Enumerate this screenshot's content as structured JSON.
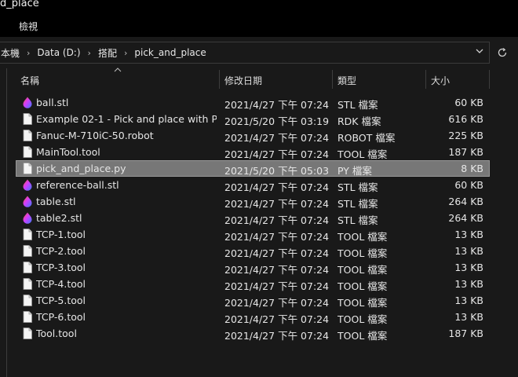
{
  "window": {
    "title": "d_place"
  },
  "ribbon": {
    "view_tab": "檢視"
  },
  "address": {
    "crumbs": [
      "本機",
      "Data (D:)",
      "搭配",
      "pick_and_place"
    ],
    "dropdown_icon": "chevron-down-icon",
    "refresh_icon": "refresh-icon"
  },
  "columns": {
    "name": "名稱",
    "date": "修改日期",
    "type": "類型",
    "size": "大小"
  },
  "files": [
    {
      "icon": "stl",
      "name": "ball.stl",
      "date": "2021/4/27 下午 07:24",
      "type": "STL 檔案",
      "size": "60 KB"
    },
    {
      "icon": "doc",
      "name": "Example 02-1 - Pick and place with Pyt...",
      "date": "2021/5/20 下午 03:19",
      "type": "RDK 檔案",
      "size": "616 KB"
    },
    {
      "icon": "doc",
      "name": "Fanuc-M-710iC-50.robot",
      "date": "2021/4/27 下午 07:24",
      "type": "ROBOT 檔案",
      "size": "225 KB"
    },
    {
      "icon": "doc",
      "name": "MainTool.tool",
      "date": "2021/4/27 下午 07:24",
      "type": "TOOL 檔案",
      "size": "187 KB"
    },
    {
      "icon": "doc",
      "name": "pick_and_place.py",
      "date": "2021/5/20 下午 05:03",
      "type": "PY 檔案",
      "size": "8 KB",
      "selected": true
    },
    {
      "icon": "stl",
      "name": "reference-ball.stl",
      "date": "2021/4/27 下午 07:24",
      "type": "STL 檔案",
      "size": "60 KB"
    },
    {
      "icon": "stl",
      "name": "table.stl",
      "date": "2021/4/27 下午 07:24",
      "type": "STL 檔案",
      "size": "264 KB"
    },
    {
      "icon": "stl",
      "name": "table2.stl",
      "date": "2021/4/27 下午 07:24",
      "type": "STL 檔案",
      "size": "264 KB"
    },
    {
      "icon": "doc",
      "name": "TCP-1.tool",
      "date": "2021/4/27 下午 07:24",
      "type": "TOOL 檔案",
      "size": "13 KB"
    },
    {
      "icon": "doc",
      "name": "TCP-2.tool",
      "date": "2021/4/27 下午 07:24",
      "type": "TOOL 檔案",
      "size": "13 KB"
    },
    {
      "icon": "doc",
      "name": "TCP-3.tool",
      "date": "2021/4/27 下午 07:24",
      "type": "TOOL 檔案",
      "size": "13 KB"
    },
    {
      "icon": "doc",
      "name": "TCP-4.tool",
      "date": "2021/4/27 下午 07:24",
      "type": "TOOL 檔案",
      "size": "13 KB"
    },
    {
      "icon": "doc",
      "name": "TCP-5.tool",
      "date": "2021/4/27 下午 07:24",
      "type": "TOOL 檔案",
      "size": "13 KB"
    },
    {
      "icon": "doc",
      "name": "TCP-6.tool",
      "date": "2021/4/27 下午 07:24",
      "type": "TOOL 檔案",
      "size": "13 KB"
    },
    {
      "icon": "doc",
      "name": "Tool.tool",
      "date": "2021/4/27 下午 07:24",
      "type": "TOOL 檔案",
      "size": "187 KB"
    }
  ],
  "colors": {
    "background": "#191919",
    "selection": "#777777",
    "text": "#e6e6e6"
  }
}
